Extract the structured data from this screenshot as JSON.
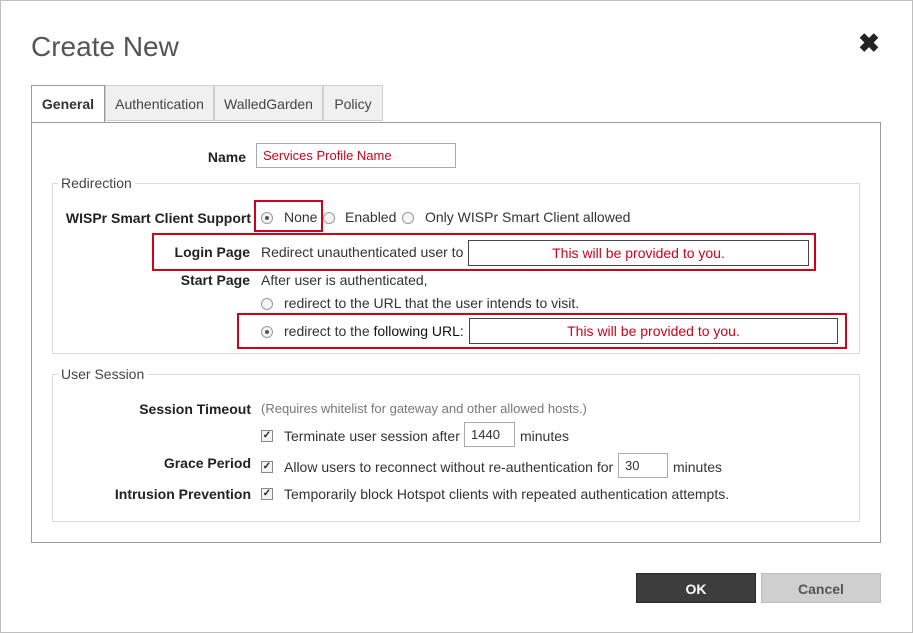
{
  "dialog": {
    "title": "Create New",
    "close_glyph": "✖"
  },
  "tabs": [
    {
      "label": "General",
      "active": true
    },
    {
      "label": "Authentication",
      "active": false
    },
    {
      "label": "WalledGarden",
      "active": false
    },
    {
      "label": "Policy",
      "active": false
    }
  ],
  "name": {
    "label": "Name",
    "value": "Services Profile Name"
  },
  "redirection": {
    "legend": "Redirection",
    "wispr_label": "WISPr Smart Client Support",
    "wispr_options": [
      {
        "label": "None",
        "checked": true
      },
      {
        "label": "Enabled",
        "checked": false
      },
      {
        "label": "Only WISPr Smart Client allowed",
        "checked": false
      }
    ],
    "login_label": "Login Page",
    "login_text": "Redirect unauthenticated user to",
    "login_value": "This will be provided to you.",
    "start_label": "Start Page",
    "start_text": "After user is authenticated,",
    "start_option_intended": "redirect to the URL that the user intends to visit.",
    "start_option_following_prefix": "redirect to the ",
    "start_option_following_suffix": "following URL:",
    "start_value": "This will be provided to you."
  },
  "user_session": {
    "legend": "User Session",
    "timeout_label": "Session Timeout",
    "timeout_note": "(Requires whitelist for gateway and other allowed hosts.)",
    "terminate_text": "Terminate user session after",
    "terminate_value": "1440",
    "terminate_unit": "minutes",
    "grace_label": "Grace Period",
    "grace_text": "Allow users to reconnect without re-authentication for",
    "grace_value": "30",
    "grace_unit": "minutes",
    "intrusion_label": "Intrusion Prevention",
    "intrusion_text": "Temporarily block Hotspot clients with repeated authentication attempts."
  },
  "buttons": {
    "ok": "OK",
    "cancel": "Cancel"
  },
  "colors": {
    "highlight": "#d0021b",
    "ok_bg": "#3d3d3d",
    "cancel_bg": "#cfcfcf"
  }
}
